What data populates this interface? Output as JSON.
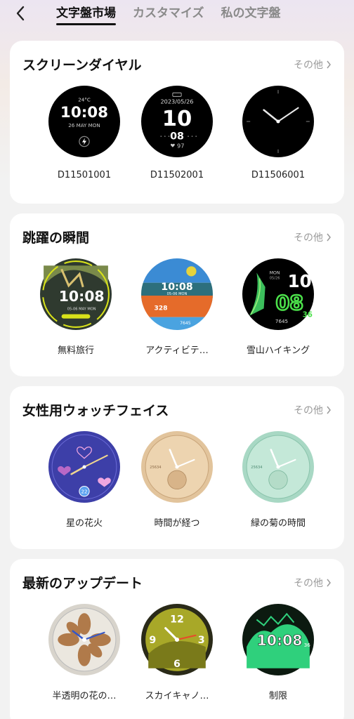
{
  "nav": {
    "tabs": [
      {
        "label": "文字盤市場",
        "active": true
      },
      {
        "label": "カスタマイズ",
        "active": false
      },
      {
        "label": "私の文字盤",
        "active": false
      }
    ]
  },
  "sections": [
    {
      "title": "スクリーンダイヤル",
      "more": "その他",
      "faces": [
        {
          "name": "D11501001",
          "temp": "24°C",
          "time": "10:08",
          "date": "26 MAY MON"
        },
        {
          "name": "D11502001",
          "date": "2023/05/26",
          "big": "10",
          "small": "08",
          "hr": "97"
        },
        {
          "name": "D11506001"
        }
      ]
    },
    {
      "title": "跳躍の瞬間",
      "more": "その他",
      "faces": [
        {
          "name": "無料旅行",
          "time": "10:08",
          "date": "05-06 MAY MON"
        },
        {
          "name": "アクティビテ…",
          "time": "10:08",
          "date": "05-06 MON",
          "kcal": "328",
          "steps": "7645"
        },
        {
          "name": "雪山ハイキング",
          "hour": "10",
          "min": "08",
          "sec": "36",
          "steps": "7645",
          "day": "MON",
          "date": "05/26"
        }
      ]
    },
    {
      "title": "女性用ウォッチフェイス",
      "more": "その他",
      "faces": [
        {
          "name": "星の花火",
          "num": "22"
        },
        {
          "name": "時間が経つ",
          "steps": "25634"
        },
        {
          "name": "緑の菊の時間",
          "steps": "25634"
        }
      ]
    },
    {
      "title": "最新のアップデート",
      "more": "その他",
      "faces": [
        {
          "name": "半透明の花の…"
        },
        {
          "name": "スカイキャノ…"
        },
        {
          "name": "制限",
          "time": "10:08",
          "sec": "36"
        }
      ]
    }
  ]
}
